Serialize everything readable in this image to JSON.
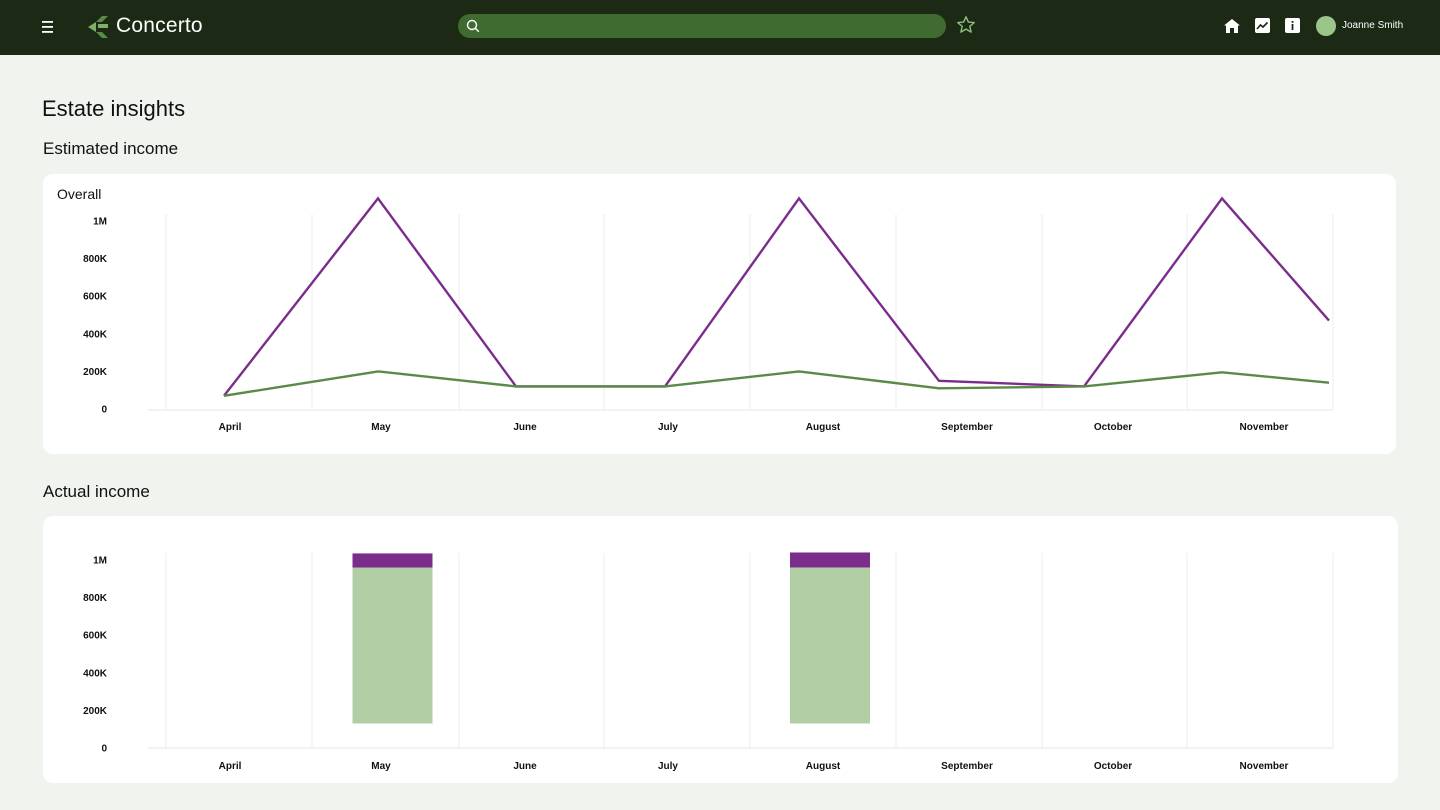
{
  "app": {
    "name": "Concerto"
  },
  "header": {
    "search": {
      "value": "",
      "placeholder": ""
    },
    "icons": [
      "menu-icon",
      "logo-icon",
      "search-icon",
      "star-icon",
      "home-icon",
      "analytics-icon",
      "info-icon"
    ],
    "user": {
      "name": "Joanne Smith"
    }
  },
  "page": {
    "title": "Estate insights"
  },
  "sections": {
    "estimated": {
      "title": "Estimated income",
      "card_label": "Overall"
    },
    "actual": {
      "title": "Actual income"
    }
  },
  "colors": {
    "header_bg": "#1c2a15",
    "search_bg": "#3f6a30",
    "purple": "#7b2d8b",
    "green": "#5b8a48",
    "light_green": "#b2cea5",
    "page_bg": "#f1f3ef"
  },
  "chart_data": [
    {
      "type": "line",
      "categories": [
        "April",
        "May",
        "June",
        "July",
        "August",
        "September",
        "October",
        "November"
      ],
      "x": [
        0,
        1,
        2,
        3,
        4,
        5,
        6,
        7
      ],
      "series": [
        {
          "values": [
            70000,
            1120000,
            120000,
            120000,
            1120000,
            150000,
            120000,
            1120000,
            470000
          ]
        },
        {
          "values": [
            70000,
            200000,
            120000,
            120000,
            200000,
            110000,
            120000,
            195000,
            140000
          ]
        }
      ],
      "yticks": [
        "0",
        "200K",
        "400K",
        "600K",
        "800K",
        "1M"
      ],
      "ylim": [
        0,
        1040000
      ],
      "grid": "vertical"
    },
    {
      "type": "bar",
      "stacked": true,
      "categories": [
        "April",
        "May",
        "June",
        "July",
        "August",
        "September",
        "October",
        "November"
      ],
      "series": [
        {
          "values": [
            0,
            130000,
            0,
            0,
            130000,
            0,
            0,
            0
          ],
          "hidden_base": true
        },
        {
          "values": [
            0,
            830000,
            0,
            0,
            830000,
            0,
            0,
            0
          ]
        },
        {
          "values": [
            0,
            75000,
            0,
            0,
            80000,
            0,
            0,
            0
          ]
        }
      ],
      "yticks": [
        "0",
        "200K",
        "400K",
        "600K",
        "800K",
        "1M"
      ],
      "ylim": [
        0,
        1040000
      ],
      "grid": "vertical"
    }
  ]
}
